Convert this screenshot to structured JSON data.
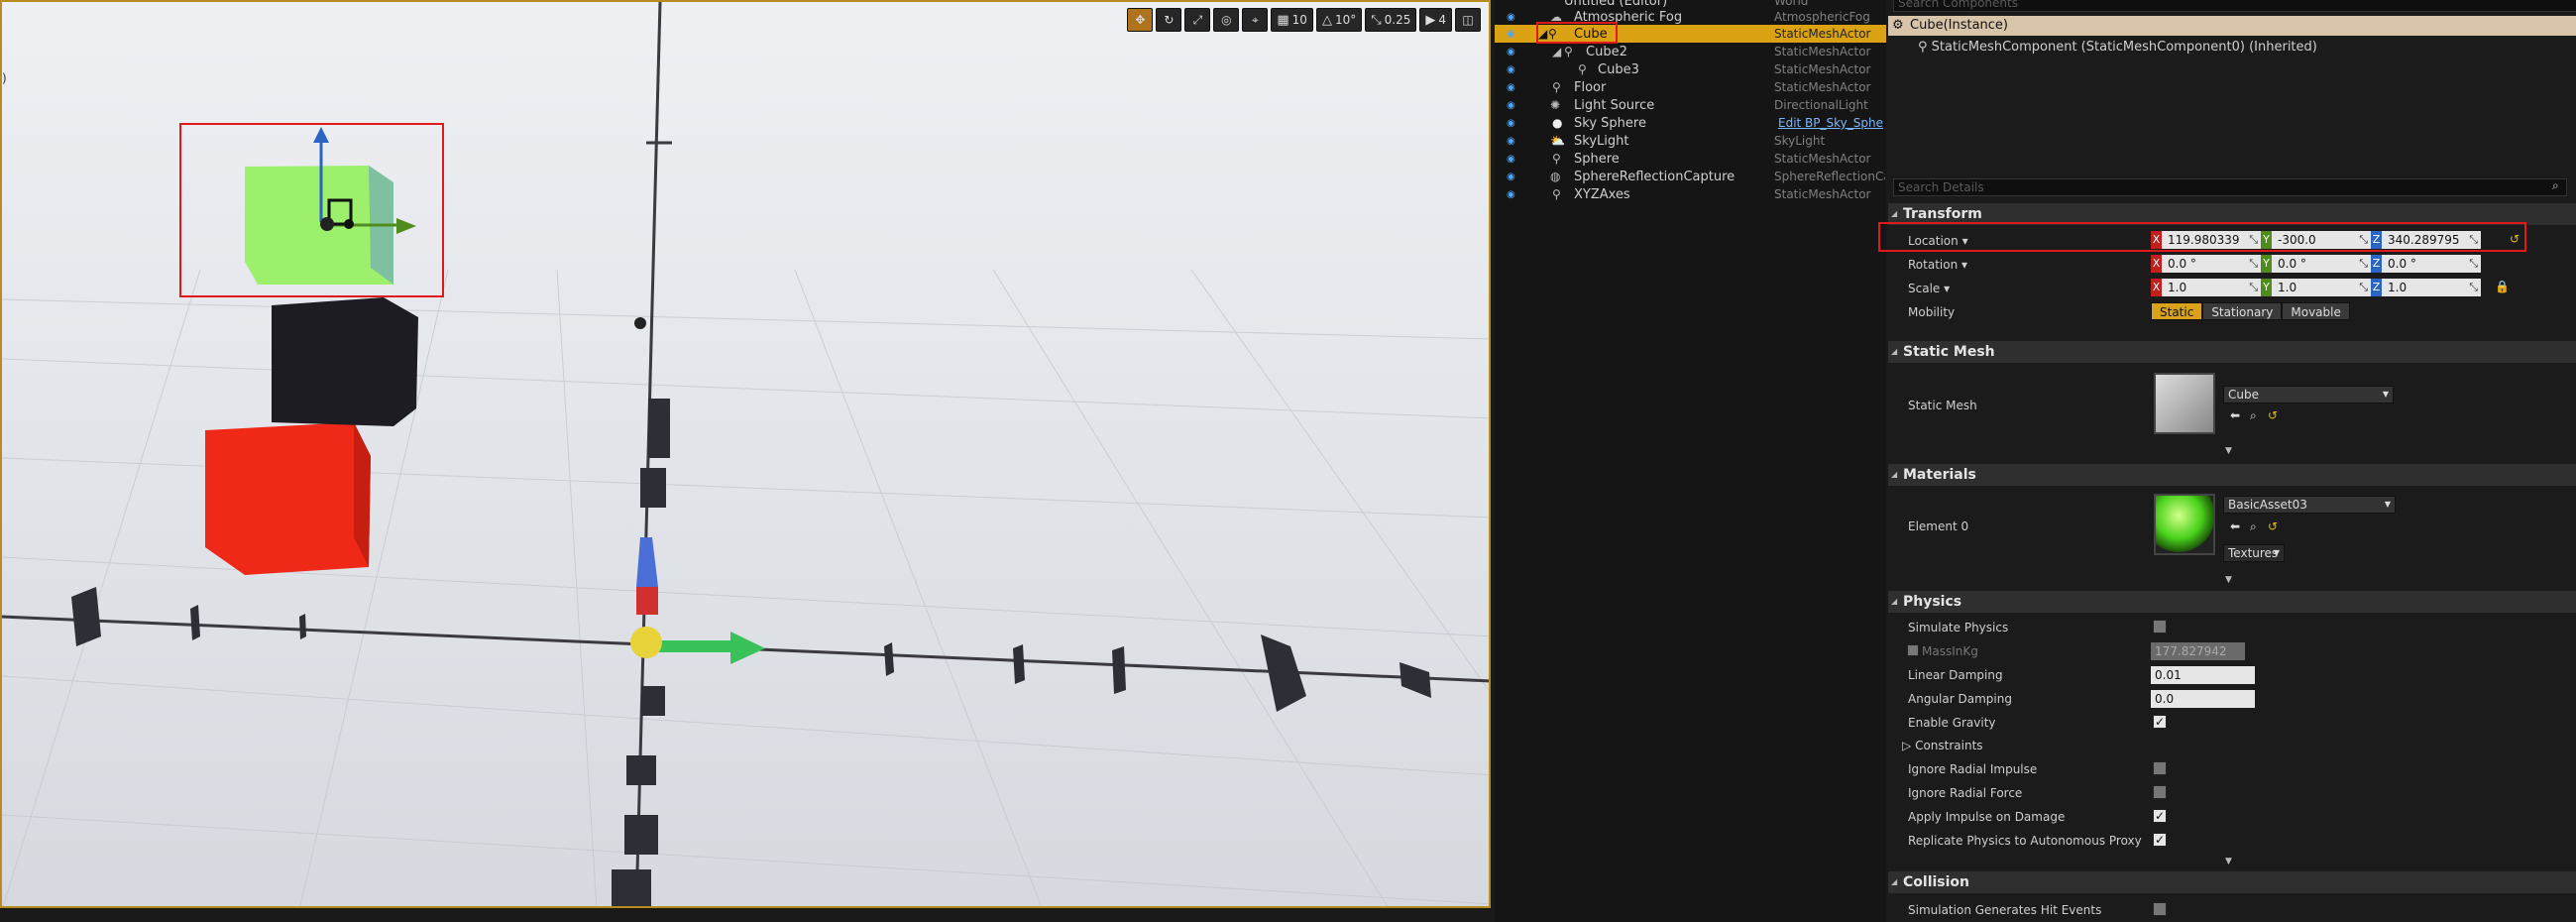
{
  "viewport": {
    "toolbar": {
      "grid_snap": "10",
      "rot_snap": "10°",
      "scale_snap": "0.25",
      "cam_speed": "4"
    }
  },
  "outliner": {
    "rows": [
      {
        "name": "Untitled (Editor)",
        "type": "World"
      },
      {
        "name": "Atmospheric Fog",
        "type": "AtmosphericFog"
      },
      {
        "name": "Cube",
        "type": "StaticMeshActor"
      },
      {
        "name": "Cube2",
        "type": "StaticMeshActor"
      },
      {
        "name": "Cube3",
        "type": "StaticMeshActor"
      },
      {
        "name": "Floor",
        "type": "StaticMeshActor"
      },
      {
        "name": "Light Source",
        "type": "DirectionalLight"
      },
      {
        "name": "Sky Sphere",
        "type": "Edit BP_Sky_Sphe"
      },
      {
        "name": "SkyLight",
        "type": "SkyLight"
      },
      {
        "name": "Sphere",
        "type": "StaticMeshActor"
      },
      {
        "name": "SphereReflectionCapture",
        "type": "SphereReflectionCa"
      },
      {
        "name": "XYZAxes",
        "type": "StaticMeshActor"
      }
    ]
  },
  "details": {
    "search_components": "Search Components",
    "component_title": "Cube(Instance)",
    "component_child": "StaticMeshComponent (StaticMeshComponent0) (Inherited)",
    "search_details": "Search Details",
    "transform": {
      "title": "Transform",
      "location_label": "Location",
      "location": {
        "x": "119.980339",
        "y": "-300.0",
        "z": "340.289795"
      },
      "rotation_label": "Rotation",
      "rotation": {
        "x": "0.0 °",
        "y": "0.0 °",
        "z": "0.0 °"
      },
      "scale_label": "Scale",
      "scale": {
        "x": "1.0",
        "y": "1.0",
        "z": "1.0"
      },
      "mobility_label": "Mobility",
      "mobility": [
        "Static",
        "Stationary",
        "Movable"
      ]
    },
    "static_mesh": {
      "title": "Static Mesh",
      "label": "Static Mesh",
      "value": "Cube"
    },
    "materials": {
      "title": "Materials",
      "label": "Element 0",
      "value": "BasicAsset03",
      "textures": "Textures"
    },
    "physics": {
      "title": "Physics",
      "simulate": "Simulate Physics",
      "mass_label": "MassInKg",
      "mass_value": "177.827942",
      "linear_label": "Linear Damping",
      "linear_value": "0.01",
      "angular_label": "Angular Damping",
      "angular_value": "0.0",
      "gravity": "Enable Gravity",
      "constraints": "Constraints",
      "radial_impulse": "Ignore Radial Impulse",
      "radial_force": "Ignore Radial Force",
      "impulse_damage": "Apply Impulse on Damage",
      "replicate": "Replicate Physics to Autonomous Proxy"
    },
    "collision": {
      "title": "Collision",
      "hit_events": "Simulation Generates Hit Events"
    }
  },
  "colors": {
    "selection": "#dba213",
    "highlight_box": "#e0191a",
    "axis_x": "#c21e1e",
    "axis_y": "#4e8c1c",
    "axis_z": "#2b64c2"
  }
}
